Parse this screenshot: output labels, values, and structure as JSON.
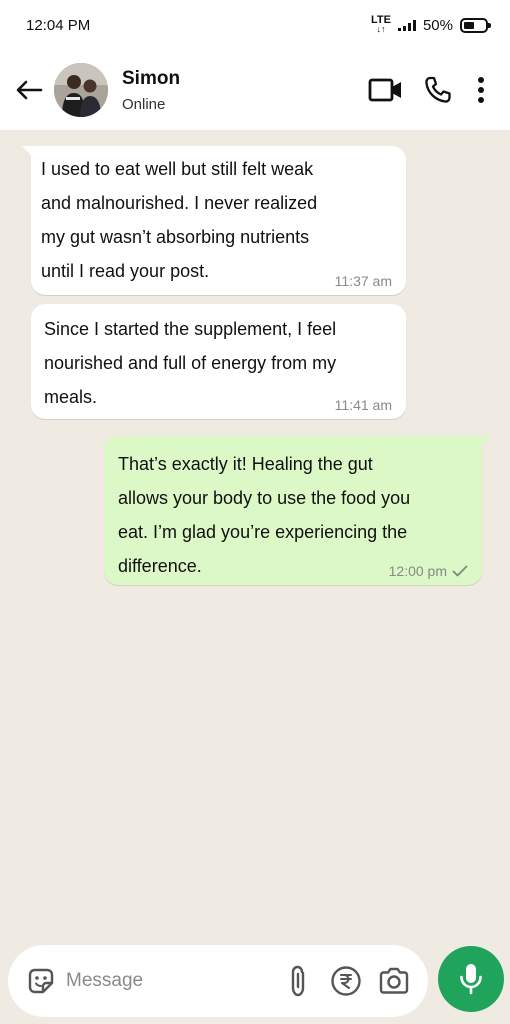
{
  "status_bar": {
    "time": "12:04 PM",
    "network": "LTE",
    "network_arrows": "↓↑",
    "battery_percent": "50%",
    "battery_level": 0.5
  },
  "header": {
    "contact_name": "Simon",
    "contact_status": "Online",
    "icons": [
      "back-arrow-icon",
      "video-call-icon",
      "phone-icon",
      "more-vertical-icon"
    ]
  },
  "messages": [
    {
      "direction": "incoming",
      "lines": [
        "I used to eat well but still felt weak",
        "and malnourished. I never realized",
        "my gut wasn’t absorbing nutrients",
        "until I read your post."
      ],
      "time": "11:37 am"
    },
    {
      "direction": "incoming",
      "lines": [
        "Since I started the supplement, I feel",
        "nourished and full of energy from my",
        "meals."
      ],
      "time": "11:41 am"
    },
    {
      "direction": "outgoing",
      "lines": [
        "That’s exactly it! Healing the gut",
        "allows your body to use the food you",
        "eat. I’m glad you’re experiencing the",
        "difference."
      ],
      "time": "12:00 pm",
      "status_icon": "single-check-icon"
    }
  ],
  "composer": {
    "placeholder": "Message",
    "icons": [
      "sticker-icon",
      "attach-icon",
      "rupee-payment-icon",
      "camera-icon",
      "mic-icon"
    ]
  },
  "colors": {
    "chat_background": "#efeae2",
    "incoming_bubble": "#ffffff",
    "outgoing_bubble": "#dcf8c6",
    "mic_button": "#20a45c",
    "timestamp": "#888888"
  }
}
